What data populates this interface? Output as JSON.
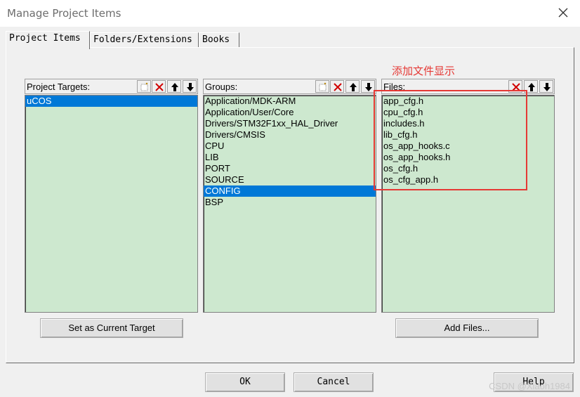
{
  "window": {
    "title": "Manage Project Items"
  },
  "tabs": [
    {
      "label": "Project Items"
    },
    {
      "label": "Folders/Extensions"
    },
    {
      "label": "Books"
    }
  ],
  "targets": {
    "header": "Project Targets:",
    "items": [
      "uCOS"
    ],
    "selected": "uCOS"
  },
  "groups": {
    "header": "Groups:",
    "items": [
      "Application/MDK-ARM",
      "Application/User/Core",
      "Drivers/STM32F1xx_HAL_Driver",
      "Drivers/CMSIS",
      "CPU",
      "LIB",
      "PORT",
      "SOURCE",
      "CONFIG",
      "BSP"
    ],
    "selected": "CONFIG"
  },
  "files": {
    "header": "Files:",
    "items": [
      "app_cfg.h",
      "cpu_cfg.h",
      "includes.h",
      "lib_cfg.h",
      "os_app_hooks.c",
      "os_app_hooks.h",
      "os_cfg.h",
      "os_cfg_app.h"
    ]
  },
  "annotation": {
    "text": "添加文件显示",
    "color": "#e53935"
  },
  "buttons": {
    "set_target": "Set as Current Target",
    "add_files": "Add Files...",
    "ok": "OK",
    "cancel": "Cancel",
    "help": "Help"
  },
  "watermark": "CSDN @Xiaoh1984",
  "colors": {
    "list_bg": "#cde8cf",
    "selection": "#0078d7",
    "annotation": "#e53935"
  },
  "icons": [
    "new-item-icon",
    "delete-icon",
    "move-up-icon",
    "move-down-icon",
    "close-icon"
  ]
}
